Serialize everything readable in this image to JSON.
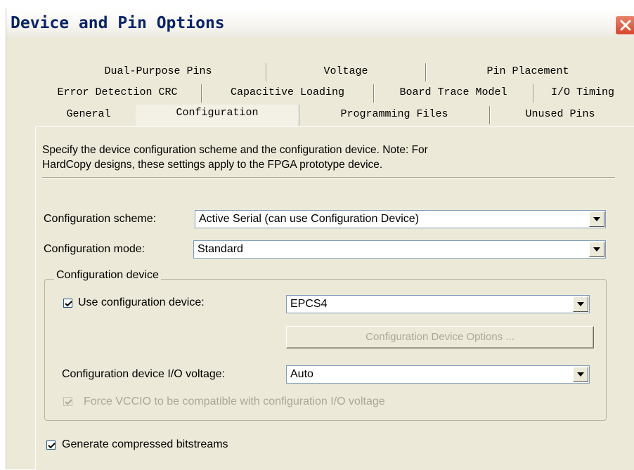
{
  "window": {
    "title": "Device and Pin Options"
  },
  "tabs": {
    "row1": [
      "Dual-Purpose Pins",
      "Voltage",
      "Pin Placement"
    ],
    "row2": [
      "Error Detection CRC",
      "Capacitive Loading",
      "Board Trace Model",
      "I/O Timing"
    ],
    "row3": [
      "General",
      "Configuration",
      "Programming Files",
      "Unused Pins"
    ],
    "active": "Configuration"
  },
  "panel": {
    "description_line1": "Specify the device configuration scheme and the configuration device. Note: For",
    "description_line2": "HardCopy designs, these settings apply to the FPGA prototype device.",
    "scheme": {
      "label": "Configuration scheme:",
      "value": "Active Serial (can use Configuration Device)"
    },
    "mode": {
      "label": "Configuration mode:",
      "value": "Standard"
    },
    "device_group": {
      "title": "Configuration device",
      "use_device": {
        "label": "Use configuration device:",
        "checked": true,
        "value": "EPCS4"
      },
      "options_button": "Configuration Device Options ...",
      "io_voltage": {
        "label": "Configuration device I/O voltage:",
        "value": "Auto"
      },
      "force_vccio": {
        "label": "Force VCCIO to be compatible with configuration I/O voltage",
        "checked": true,
        "enabled": false
      }
    },
    "compressed": {
      "label": "Generate compressed bitstreams",
      "checked": true
    }
  },
  "colors": {
    "title_text": "#0a246a",
    "dialog_bg": "#ece9d8",
    "close_button": "#d7462c",
    "disabled_text": "#aca899"
  }
}
